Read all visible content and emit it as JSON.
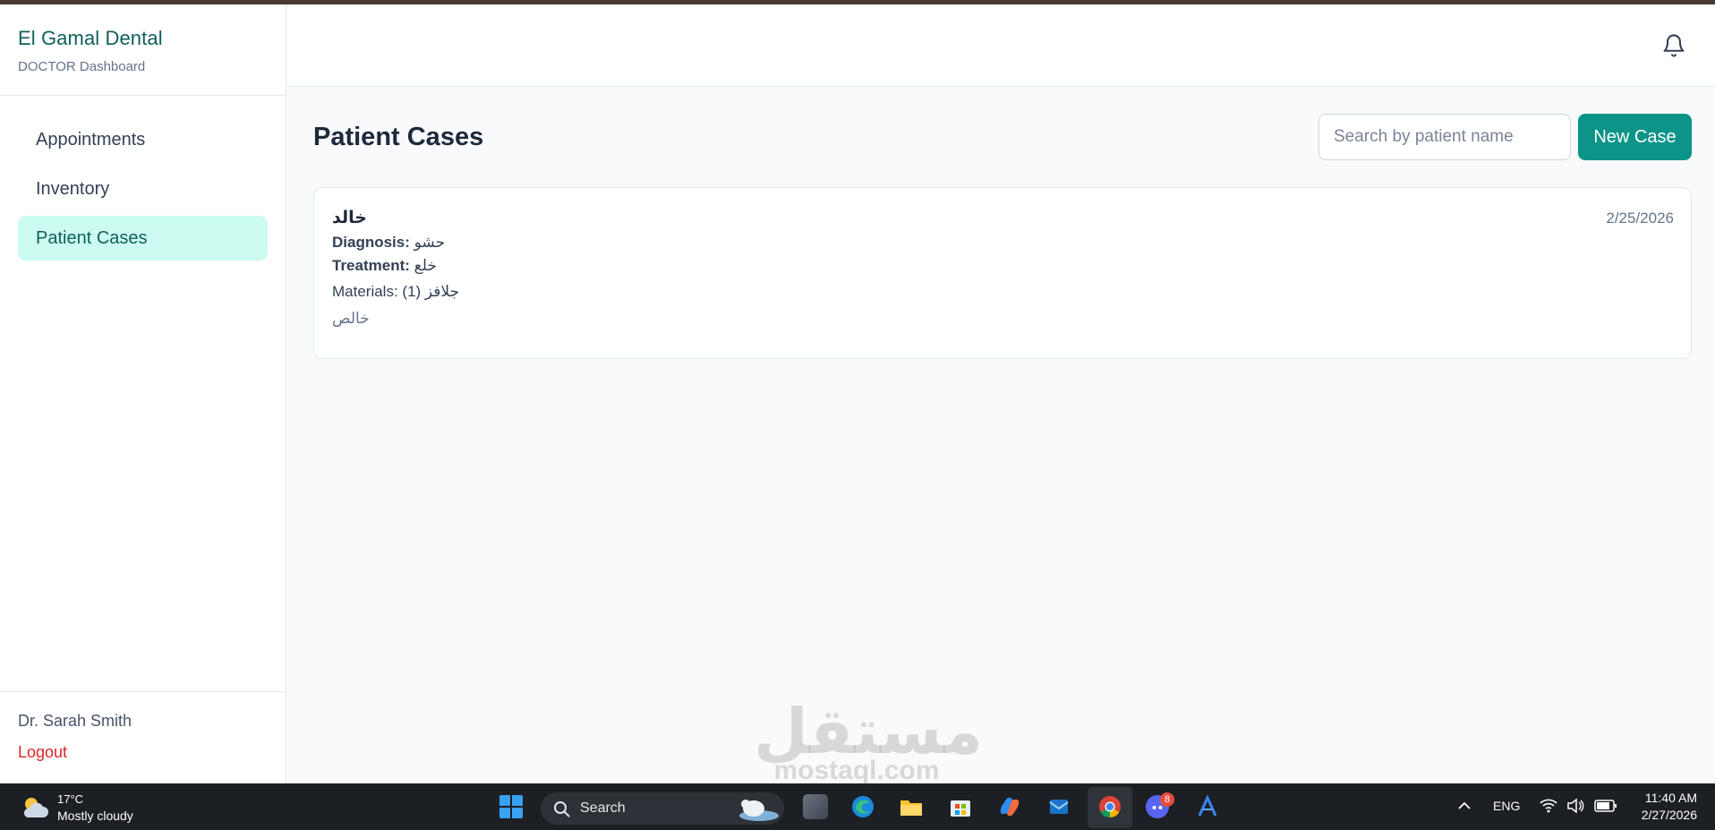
{
  "app": {
    "brand_title": "El Gamal Dental",
    "brand_subtitle": "DOCTOR Dashboard",
    "accent_color": "#0d9488"
  },
  "sidebar": {
    "items": [
      {
        "label": "Appointments",
        "active": false
      },
      {
        "label": "Inventory",
        "active": false
      },
      {
        "label": "Patient Cases",
        "active": true
      }
    ],
    "user_name": "Dr. Sarah Smith",
    "logout_label": "Logout"
  },
  "header": {
    "notification_icon": "bell-icon"
  },
  "main": {
    "title": "Patient Cases",
    "search_placeholder": "Search by patient name",
    "new_case_label": "New Case",
    "cases": [
      {
        "patient_name": "خالد",
        "date": "2/25/2026",
        "diagnosis_label": "Diagnosis:",
        "diagnosis": "حشو",
        "treatment_label": "Treatment:",
        "treatment": "خلع",
        "materials": "Materials: (1) جلافز",
        "notes": "خالص"
      }
    ]
  },
  "watermark": {
    "arabic": "مستقل",
    "latin": "mostaql.com"
  },
  "taskbar": {
    "temperature": "17°C",
    "weather": "Mostly cloudy",
    "search_label": "Search",
    "discord_badge": "8",
    "language": "ENG",
    "time": "11:40 AM",
    "date": "2/27/2026"
  }
}
